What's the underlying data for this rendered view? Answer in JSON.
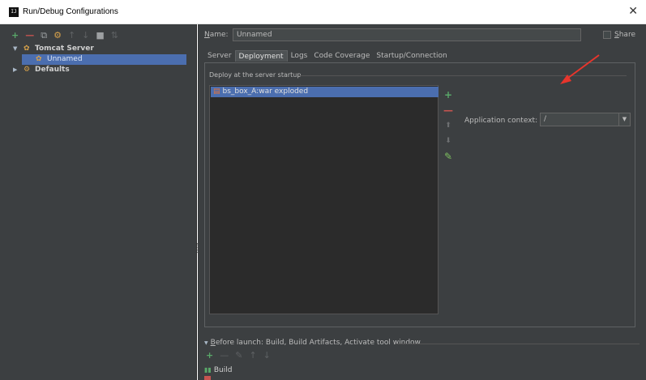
{
  "window": {
    "title": "Run/Debug Configurations",
    "app_icon": "IJ",
    "close_glyph": "✕"
  },
  "toolbar": {
    "icons": [
      "add-icon",
      "remove-icon",
      "copy-icon",
      "wrench-icon",
      "move-up-icon",
      "move-down-icon",
      "folder-icon",
      "sort-icon"
    ]
  },
  "tree": {
    "tomcat_server": "Tomcat Server",
    "unnamed": "Unnamed",
    "defaults": "Defaults"
  },
  "form": {
    "name_label_prefix": "N",
    "name_label_suffix": "ame:",
    "name_value": "Unnamed",
    "share_label_prefix": "S",
    "share_label_suffix": "hare"
  },
  "tabs": [
    "Server",
    "Deployment",
    "Logs",
    "Code Coverage",
    "Startup/Connection"
  ],
  "active_tab": "Deployment",
  "deployment": {
    "section_title": "Deploy at the server startup",
    "items": [
      "bs_box_A:war exploded"
    ],
    "context_label": "Application context:",
    "context_value": "/"
  },
  "before_launch": {
    "label_prefix": "B",
    "label_suffix": "efore launch: Build, Build Artifacts, Activate tool window",
    "build_item": "Build"
  },
  "colors": {
    "panel": "#3c3f41",
    "selection": "#4b6eaf",
    "accent_red": "#e8352c"
  }
}
